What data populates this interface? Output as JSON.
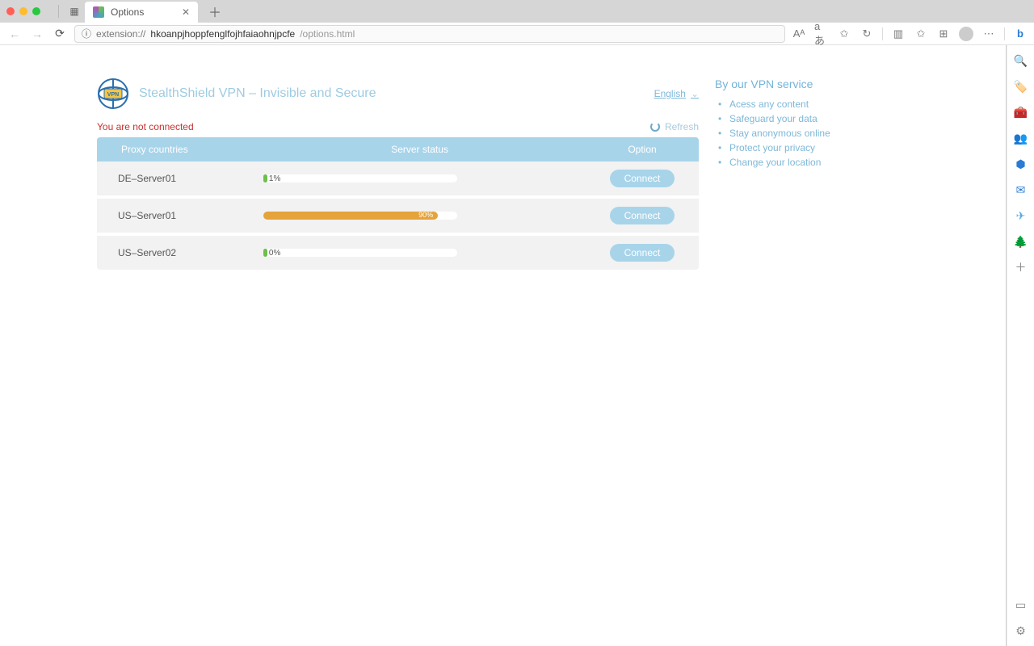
{
  "browser": {
    "tab_title": "Options",
    "url_scheme": "extension://",
    "url_host": "hkoanpjhoppfenglfojhfaiaohnjpcfe",
    "url_path": "/options.html"
  },
  "toolbar_icons": {
    "read_aloud": "Aᴬ",
    "translate": "aあ",
    "favorites_star": "✩",
    "sync": "↻",
    "split": "▥",
    "bookmarks": "✩",
    "collections": "⊞",
    "more": "⋯",
    "bing": "b"
  },
  "right_rail": [
    {
      "name": "search-icon",
      "glyph": "🔍",
      "color": "#6a4bbf"
    },
    {
      "name": "tag-icon",
      "glyph": "🏷️",
      "color": "#4b6fe6"
    },
    {
      "name": "shopping-icon",
      "glyph": "🧰",
      "color": "#d9534f"
    },
    {
      "name": "people-icon",
      "glyph": "👥",
      "color": "#8e6cc9"
    },
    {
      "name": "office-icon",
      "glyph": "⬢",
      "color": "#2a7bd4"
    },
    {
      "name": "outlook-icon",
      "glyph": "✉",
      "color": "#2a7bd4"
    },
    {
      "name": "send-icon",
      "glyph": "✈",
      "color": "#5aa9e6"
    },
    {
      "name": "tree-icon",
      "glyph": "🌲",
      "color": "#2e8b57"
    },
    {
      "name": "add-icon",
      "glyph": "＋",
      "color": "#888"
    }
  ],
  "right_rail_bottom": [
    {
      "name": "panel-icon",
      "glyph": "▭",
      "color": "#888"
    },
    {
      "name": "settings-icon",
      "glyph": "⚙",
      "color": "#888"
    }
  ],
  "app": {
    "title": "StealthShield VPN – Invisible and Secure",
    "language": "English",
    "status_text": "You are not connected",
    "refresh_label": "Refresh"
  },
  "table": {
    "headers": {
      "country": "Proxy countries",
      "status": "Server status",
      "option": "Option"
    },
    "rows": [
      {
        "name": "DE–Server01",
        "percent": 1,
        "percent_label": "1%",
        "color": "green",
        "button": "Connect"
      },
      {
        "name": "US–Server01",
        "percent": 90,
        "percent_label": "90%",
        "color": "orange",
        "button": "Connect"
      },
      {
        "name": "US–Server02",
        "percent": 0,
        "percent_label": "0%",
        "color": "green",
        "button": "Connect"
      }
    ]
  },
  "sidebar": {
    "title": "By our VPN service",
    "items": [
      "Acess any content",
      "Safeguard your data",
      "Stay anonymous online",
      "Protect your privacy",
      "Change your location"
    ]
  }
}
